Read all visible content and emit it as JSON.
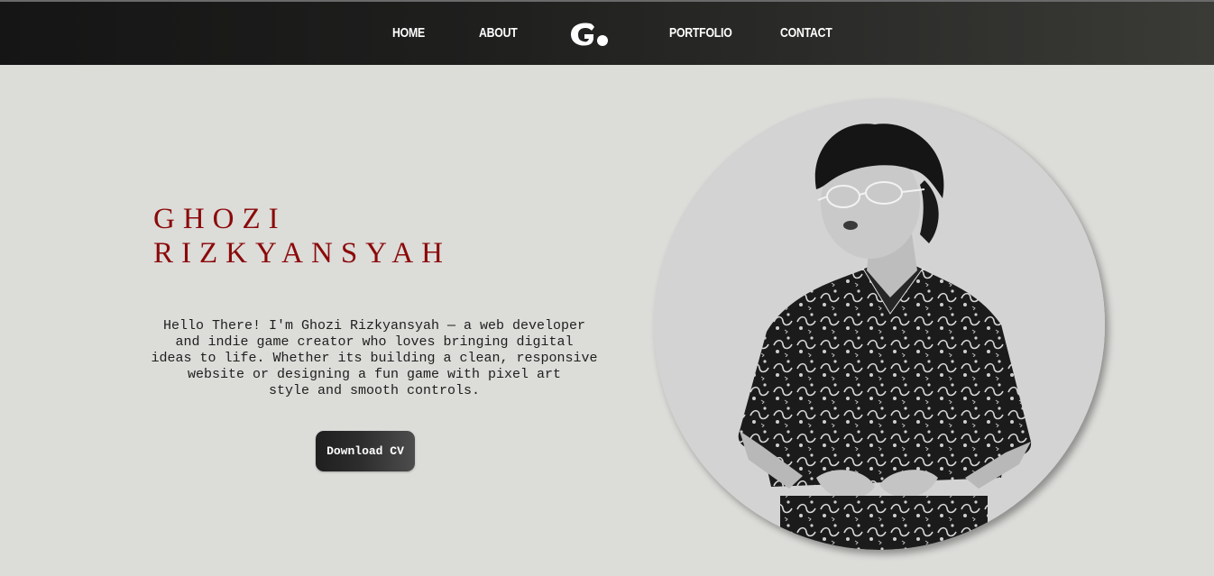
{
  "nav": {
    "items": [
      {
        "label": "HOME"
      },
      {
        "label": "ABOUT"
      },
      {
        "label": "PORTFOLIO"
      },
      {
        "label": "CONTACT"
      }
    ],
    "logo_text": "G.",
    "logo_icon": "brand-logo"
  },
  "hero": {
    "name_line1": "GHOZI",
    "name_line2": "RIZKYANSYAH",
    "intro_lines": [
      "Hello There! I'm Ghozi Rizkyansyah — a web developer",
      "and indie game creator who loves bringing digital",
      "ideas to life. Whether its building a clean, responsive",
      "website or designing a fun game with pixel art",
      "style and smooth controls."
    ],
    "cv_button_label": "Download CV"
  },
  "photo": {
    "subject": "portrait-photo"
  },
  "colors": {
    "background": "#dcdcd9",
    "nav_bg": "#1a1a1a",
    "name_color": "#8b0a0a",
    "text_color": "#1e1e1e",
    "button_bg": "#2a2a2a",
    "button_text": "#ffffff"
  }
}
